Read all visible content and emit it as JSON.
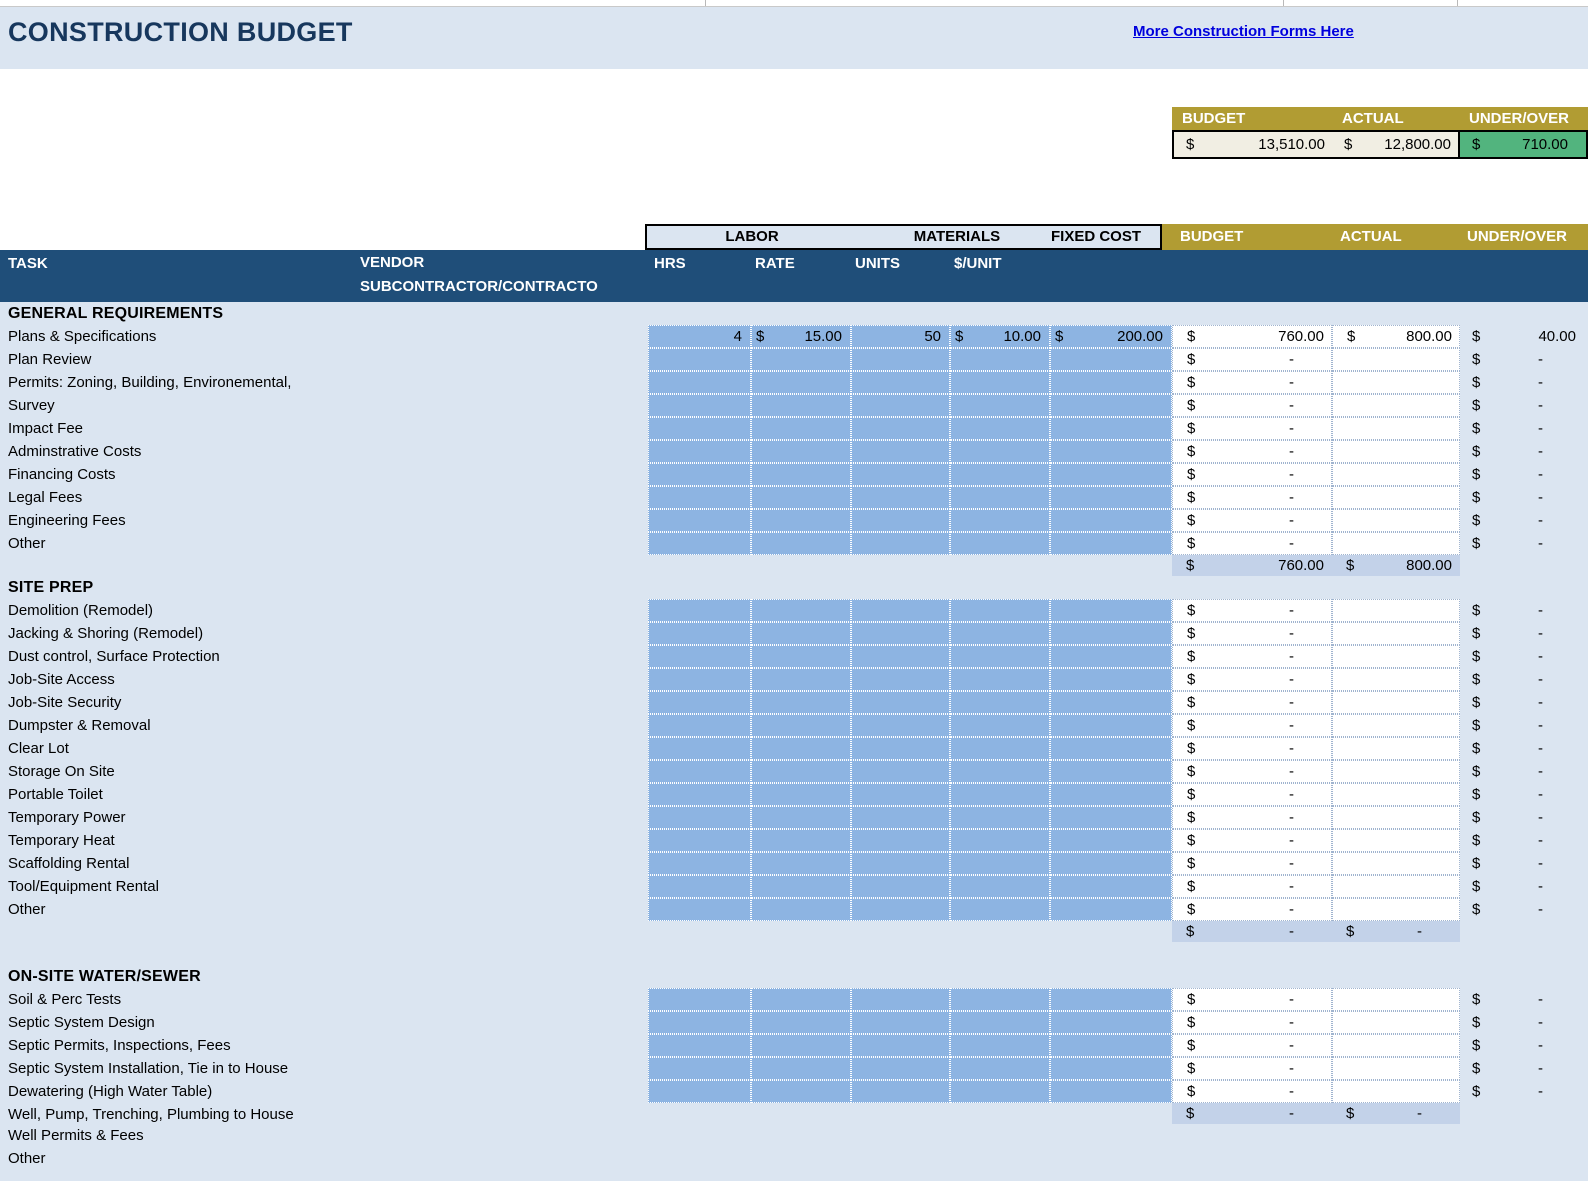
{
  "currency": "$",
  "page": {
    "title": "CONSTRUCTION BUDGET",
    "link": "More Construction Forms Here"
  },
  "summary": {
    "headers": {
      "budget": "BUDGET",
      "actual": "ACTUAL",
      "under_over": "UNDER/OVER"
    },
    "budget": "13,510.00",
    "actual": "12,800.00",
    "under_over": "710.00"
  },
  "columns": {
    "groups": {
      "labor": "LABOR",
      "materials": "MATERIALS",
      "fixed_cost": "FIXED COST"
    },
    "money": {
      "budget": "BUDGET",
      "actual": "ACTUAL",
      "under_over": "UNDER/OVER"
    },
    "task": "TASK",
    "vendor_line1": "VENDOR",
    "vendor_line2": "SUBCONTRACTOR/CONTRACTO",
    "hrs": "HRS",
    "rate": "RATE",
    "units": "UNITS",
    "unit_cost": "$/UNIT"
  },
  "colors": {
    "header_blue": "#1f4e79",
    "band_olive": "#b19c33",
    "input_blue": "#8db4e2",
    "under_green": "#52b47e",
    "page_blue": "#dbe5f1",
    "cream": "#f1eee3",
    "subtotal_blue": "#c3d2e9",
    "title_navy": "#17375d",
    "link_blue": "#0000dd"
  },
  "sections": [
    {
      "title": "GENERAL REQUIREMENTS",
      "rows": [
        {
          "task": "Plans & Specifications",
          "hrs": "4",
          "rate": "15.00",
          "units": "50",
          "unit_cost": "10.00",
          "fixed_cost": "200.00",
          "budget": "760.00",
          "actual": "800.00",
          "under_over": "40.00"
        },
        {
          "task": "Plan Review",
          "budget": "-",
          "actual": "",
          "under_over": "-"
        },
        {
          "task": "Permits: Zoning, Building, Environemental,",
          "budget": "-",
          "actual": "",
          "under_over": "-"
        },
        {
          "task": "Survey",
          "budget": "-",
          "actual": "",
          "under_over": "-"
        },
        {
          "task": "Impact Fee",
          "budget": "-",
          "actual": "",
          "under_over": "-"
        },
        {
          "task": "Adminstrative Costs",
          "budget": "-",
          "actual": "",
          "under_over": "-"
        },
        {
          "task": "Financing Costs",
          "budget": "-",
          "actual": "",
          "under_over": "-"
        },
        {
          "task": "Legal Fees",
          "budget": "-",
          "actual": "",
          "under_over": "-"
        },
        {
          "task": "Engineering Fees",
          "budget": "-",
          "actual": "",
          "under_over": "-"
        },
        {
          "task": "Other",
          "budget": "-",
          "actual": "",
          "under_over": "-"
        }
      ],
      "subtotal": {
        "task": "",
        "budget": "760.00",
        "actual": "800.00"
      },
      "extra_rows": []
    },
    {
      "title": "SITE PREP",
      "rows": [
        {
          "task": "Demolition (Remodel)",
          "budget": "-",
          "actual": "",
          "under_over": "-"
        },
        {
          "task": "Jacking & Shoring (Remodel)",
          "budget": "-",
          "actual": "",
          "under_over": "-"
        },
        {
          "task": "Dust control, Surface Protection",
          "budget": "-",
          "actual": "",
          "under_over": "-"
        },
        {
          "task": "Job-Site Access",
          "budget": "-",
          "actual": "",
          "under_over": "-"
        },
        {
          "task": "Job-Site Security",
          "budget": "-",
          "actual": "",
          "under_over": "-"
        },
        {
          "task": "Dumpster & Removal",
          "budget": "-",
          "actual": "",
          "under_over": "-"
        },
        {
          "task": "Clear Lot",
          "budget": "-",
          "actual": "",
          "under_over": "-"
        },
        {
          "task": "Storage On Site",
          "budget": "-",
          "actual": "",
          "under_over": "-"
        },
        {
          "task": "Portable Toilet",
          "budget": "-",
          "actual": "",
          "under_over": "-"
        },
        {
          "task": "Temporary Power",
          "budget": "-",
          "actual": "",
          "under_over": "-"
        },
        {
          "task": "Temporary Heat",
          "budget": "-",
          "actual": "",
          "under_over": "-"
        },
        {
          "task": "Scaffolding Rental",
          "budget": "-",
          "actual": "",
          "under_over": "-"
        },
        {
          "task": "Tool/Equipment Rental",
          "budget": "-",
          "actual": "",
          "under_over": "-"
        },
        {
          "task": "Other",
          "budget": "-",
          "actual": "",
          "under_over": "-"
        }
      ],
      "subtotal": {
        "task": "",
        "budget": "-",
        "actual": "-"
      },
      "extra_rows": []
    },
    {
      "title": "ON-SITE WATER/SEWER",
      "gap_before": true,
      "rows": [
        {
          "task": "Soil & Perc Tests",
          "budget": "-",
          "actual": "",
          "under_over": "-"
        },
        {
          "task": "Septic System Design",
          "budget": "-",
          "actual": "",
          "under_over": "-"
        },
        {
          "task": "Septic Permits, Inspections, Fees",
          "budget": "-",
          "actual": "",
          "under_over": "-"
        },
        {
          "task": "Septic System Installation, Tie in to House",
          "budget": "-",
          "actual": "",
          "under_over": "-"
        },
        {
          "task": "Dewatering (High Water Table)",
          "budget": "-",
          "actual": "",
          "under_over": "-"
        }
      ],
      "subtotal": {
        "task": "Well, Pump, Trenching, Plumbing to House",
        "budget": "-",
        "actual": "-"
      },
      "extra_rows": [
        "Well Permits & Fees",
        "Other"
      ]
    }
  ]
}
